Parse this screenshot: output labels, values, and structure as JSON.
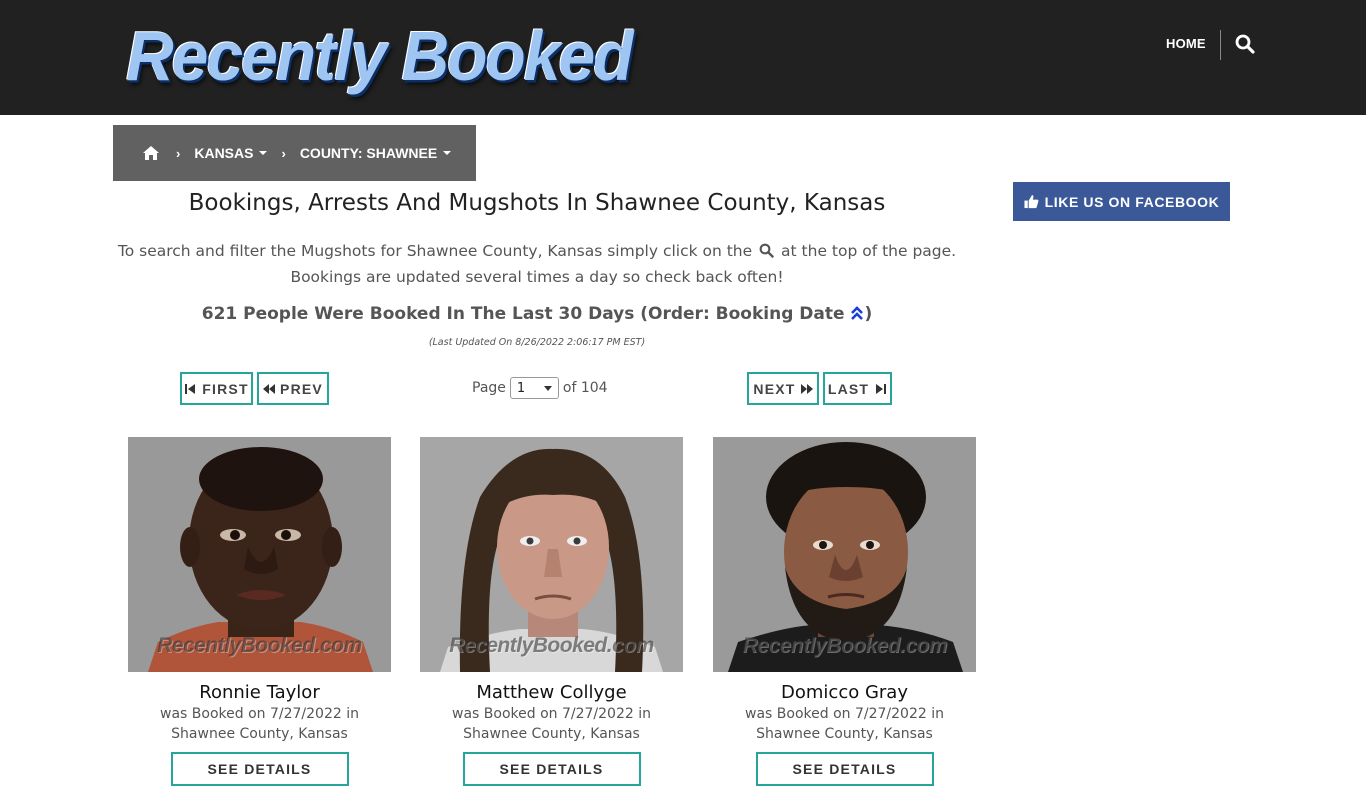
{
  "header": {
    "logo_text": "Recently Booked",
    "nav_home": "HOME"
  },
  "breadcrumb": {
    "state": "KANSAS",
    "county": "COUNTY: SHAWNEE",
    "separator": "›"
  },
  "facebook": {
    "label": "LIKE US ON FACEBOOK"
  },
  "main": {
    "title": "Bookings, Arrests And Mugshots In Shawnee County, Kansas",
    "intro_before_icon": "To search and filter the Mugshots for Shawnee County, Kansas simply click on the",
    "intro_after_icon": "at the top of the page.",
    "intro_line2": "Bookings are updated several times a day so check back often!",
    "count_text": "621 People Were Booked In The Last 30 Days (Order: Booking Date",
    "count_close": ")",
    "updated": "(Last Updated On 8/26/2022 2:06:17 PM EST)"
  },
  "pagination": {
    "first": "FIRST",
    "prev": "PREV",
    "next": "NEXT",
    "last": "LAST",
    "page_label": "Page",
    "current_page": "1",
    "of_label": "of 104"
  },
  "cards": [
    {
      "name": "Ronnie Taylor",
      "line1": "was Booked on 7/27/2022 in",
      "line2": "Shawnee County, Kansas",
      "watermark": "RecentlyBooked.com",
      "button": "SEE DETAILS"
    },
    {
      "name": "Matthew Collyge",
      "line1": "was Booked on 7/27/2022 in",
      "line2": "Shawnee County, Kansas",
      "watermark": "RecentlyBooked.com",
      "button": "SEE DETAILS"
    },
    {
      "name": "Domicco Gray",
      "line1": "was Booked on 7/27/2022 in",
      "line2": "Shawnee County, Kansas",
      "watermark": "RecentlyBooked.com",
      "button": "SEE DETAILS"
    }
  ],
  "colors": {
    "header_bg": "#212121",
    "breadcrumb_bg": "#616161",
    "facebook_blue": "#3b5998",
    "teal_border": "#26a69a"
  },
  "icons": {
    "search": "search-icon",
    "home": "home-icon",
    "thumbs_up": "thumbs-up-icon",
    "sort_up": "double-chevron-up-icon"
  }
}
